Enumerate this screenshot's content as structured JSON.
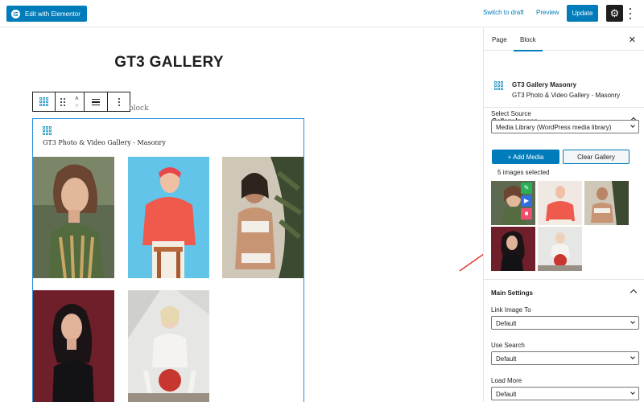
{
  "topbar": {
    "edit_elementor_label": "Edit with Elementor",
    "switch_draft_label": "Switch to draft",
    "preview_label": "Preview",
    "update_label": "Update",
    "accent_color": "#007cba"
  },
  "editor": {
    "page_title": "GT3 GALLERY",
    "behind_text": "block",
    "block_label": "GT3 Photo & Video Gallery - Masonry",
    "toolbar_icons": [
      "gallery-grid-icon",
      "drag-handle-icon",
      "move-up-down-icon",
      "align-icon",
      "more-options-icon"
    ]
  },
  "sidebar": {
    "tabs": [
      {
        "label": "Page",
        "active": false
      },
      {
        "label": "Block",
        "active": true
      }
    ],
    "close_icon": "close-icon",
    "block_title": "GT3 Gallery Masonry",
    "block_description": "GT3 Photo & Video Gallery - Masonry",
    "gallery_panel": {
      "title": "Gallery Images",
      "source_label": "Select Source",
      "source_value": "Media Library (WordPress media library)",
      "add_media_label": "+ Add Media",
      "clear_gallery_label": "Clear Gallery",
      "selected_text": "5 images selected",
      "thumb_actions": [
        "edit-icon",
        "play-icon",
        "delete-icon"
      ]
    },
    "main_settings": {
      "title": "Main Settings",
      "link_image_label": "Link Image To",
      "link_image_value": "Default",
      "use_search_label": "Use Search",
      "use_search_value": "Default",
      "load_more_label": "Load More",
      "load_more_value": "Default"
    }
  }
}
